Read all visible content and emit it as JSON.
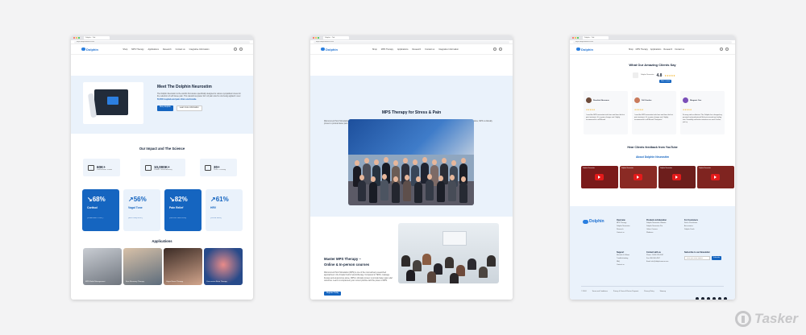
{
  "browser": {
    "tab_title": "Dolphin – Tab",
    "url": "https://dolphinneuro.com"
  },
  "nav": {
    "logo": "Dolphin",
    "links": [
      "Shop",
      "MPS Therapy",
      "Applications",
      "Research",
      "Contact us",
      "Integrative Information"
    ]
  },
  "page1": {
    "hero": {
      "title": "Meet The Dolphin Neurostim",
      "body": "The Dolphin Neurostim is the world's first device specifically designed to reduce sympathetic stress for the reduction of soft tissue pain. This natural low-power form of pain relief is now being applied in over",
      "body_bold": "50,000 hospitals and pain clinics world-wide.",
      "primary_button": "Shop Dolphin",
      "secondary_button": "Learn more information"
    },
    "impact": {
      "title": "Our Impact and The Science",
      "stats": [
        {
          "value": "60K+",
          "label": "Professionals Trained"
        },
        {
          "value": "10,000K+",
          "label": "Patients Treated Annually"
        },
        {
          "value": "30+",
          "label": "Years Of Healing"
        }
      ],
      "cards": [
        {
          "value": "68%",
          "name": "Cortisol",
          "source": "(Chalk-Mers / 2017)",
          "theme": "dark",
          "trend": "down"
        },
        {
          "value": "56%",
          "name": "Vagal Tone",
          "source": "(Bind Hoop 2017)",
          "theme": "light",
          "trend": "up"
        },
        {
          "value": "82%",
          "name": "Pain Relief",
          "source": "(ODA Am Med 2019)",
          "theme": "dark",
          "trend": "down"
        },
        {
          "value": "61%",
          "name": "HRV",
          "source": "(JCUM 2023)",
          "theme": "light",
          "trend": "up"
        }
      ]
    },
    "applications": {
      "title": "Applications",
      "items": [
        "MPS Relief Management",
        "Scar Recovery Therapy",
        "Vagus Nerve Therapy",
        "Concussion Brain Therapy"
      ]
    }
  },
  "page2": {
    "hero": {
      "title": "MPS Therapy for Stress & Pain",
      "body": "Microcurrent Point Stimulation (MPS) is one of the most actively researched approaches in the broader field of electrotherapy. Compared to TENS, massage therapy and acupuncture alone, MPS is clinically proven to provide faster pain relief outcomes. Learn to complement your current practice with the power of MPS.",
      "secondary_button": "Learn more",
      "primary_button": "Get a Free"
    },
    "course": {
      "title_line1": "Master MPS Therapy –",
      "title_line2": "Online & In-person courses",
      "body": "Microcurrent Point Stimulation (MPS) is one of the most actively researched approaches in the broader field of electrotherapy. Compared to TENS, massage therapy and acupuncture alone, MPS is clinically proven to provide faster pain relief outcomes. Learn to complement your current practice with the power of MPS.",
      "button": "Register Today"
    }
  },
  "page3": {
    "reviews": {
      "title": "What Our Amazing Clients Say",
      "rating_label": "Dolphin Neurostim",
      "rating": "4.8",
      "stars": "★★★★★",
      "rating_button": "Write a review",
      "items": [
        {
          "name": "Rosalind Neumann",
          "stars": "★★★★★",
          "text": "I used the MPS neurostim trials from and from the first pain treatment. It's a game changer and I highly recommend it to all Manual"
        },
        {
          "name": "Fell Gordon",
          "stars": "★★★★★",
          "text": "I used the MPS neurostim trials from and from the first pain treatment. It's a game changer and I highly recommend it to all Manual Therapists!"
        },
        {
          "name": "Margaret Carr",
          "stars": "★★★★★",
          "text": "So easy and so effective! The Dolphin has changed my personal and professional life by increased my healing rate. Versatility and better outcomes are much further, just try"
        }
      ]
    },
    "videos": {
      "title": "Hear Clients feedback from YouTube",
      "subtitle": "About Dolphin Neurostim",
      "items": [
        "Dolphin Neurostim",
        "Dolphin Neurostim",
        "Dolphin Neurostim",
        "Dolphin Neurostim"
      ]
    },
    "footer": {
      "logo": "Dolphin",
      "columns": [
        {
          "title": "Overview",
          "links": [
            "MPS Therapy",
            "Dolphin Neurostim",
            "Research",
            "Contact us"
          ]
        },
        {
          "title": "Products & Education",
          "links": [
            "Dolphin Neurostim Ultimate",
            "Dolphin Neurostim Pro",
            "Online Courses",
            "Webinars"
          ]
        },
        {
          "title": "For Customers",
          "links": [
            "Find a Practitioner",
            "Accessories",
            "Dolphin Deals"
          ]
        },
        {
          "title": "Support",
          "links": [
            "Manuals & Videos",
            "Troubleshooting",
            "FAQ",
            "Contact us"
          ]
        },
        {
          "title": "Contact with us",
          "links": [
            "Phone: 1-800-123-4567",
            "Fax: 800-900-4567",
            "Email: info@dolphinneuro.com"
          ]
        }
      ],
      "newsletter_title": "Subscribe to our Newsletter",
      "newsletter_placeholder": "Enter your email address",
      "newsletter_button": "Subscribe",
      "copyright": "© 2024",
      "legal": [
        "Terms and Conditions",
        "Privacy & Terms & Return Payment",
        "Privacy Policy",
        "Sitemap"
      ]
    }
  },
  "watermark": "Tasker",
  "colors": {
    "accent": "#1565c0",
    "hero_bg": "#eaf2fb",
    "star": "#f2b01e"
  }
}
